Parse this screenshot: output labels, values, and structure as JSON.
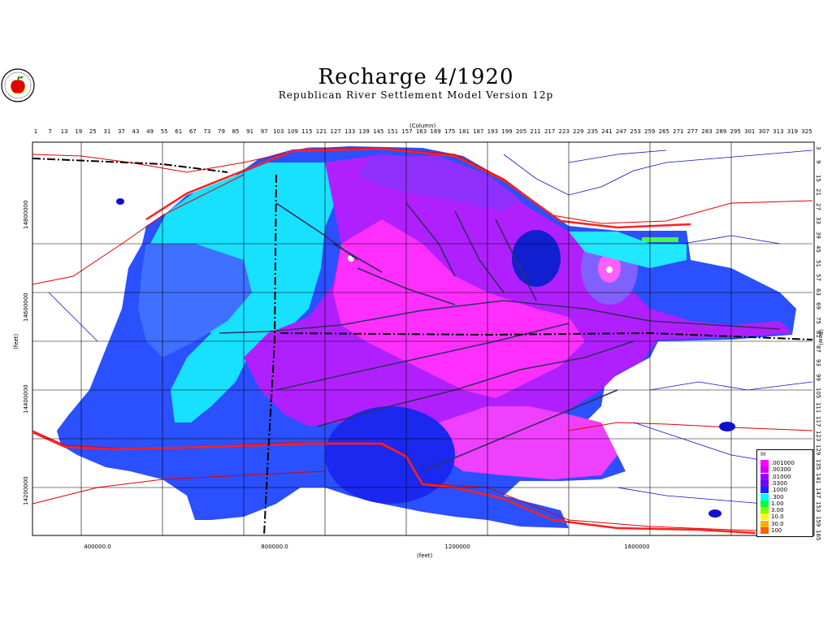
{
  "title": "Recharge   4/1920",
  "subtitle": "Republican River Settlement Model Version 12p",
  "logo": "apple-logo",
  "axes": {
    "top_label": "(Column)",
    "right_label": "(Row)",
    "bottom_label": "(feet)",
    "left_label": "(feet)",
    "column_ticks": [
      "1",
      "7",
      "13",
      "19",
      "25",
      "31",
      "37",
      "43",
      "49",
      "55",
      "61",
      "67",
      "73",
      "79",
      "85",
      "91",
      "97",
      "103",
      "109",
      "115",
      "121",
      "127",
      "133",
      "139",
      "145",
      "151",
      "157",
      "163",
      "169",
      "175",
      "181",
      "187",
      "193",
      "199",
      "205",
      "211",
      "217",
      "223",
      "229",
      "235",
      "241",
      "247",
      "253",
      "259",
      "265",
      "271",
      "277",
      "283",
      "289",
      "295",
      "301",
      "307",
      "313",
      "319",
      "325"
    ],
    "row_ticks": [
      "3",
      "9",
      "15",
      "21",
      "27",
      "33",
      "39",
      "45",
      "51",
      "57",
      "63",
      "69",
      "75",
      "81",
      "87",
      "93",
      "99",
      "105",
      "111",
      "117",
      "123",
      "129",
      "135",
      "141",
      "147",
      "153",
      "159",
      "165"
    ],
    "x_ticks": [
      "400000.0",
      "800000.0",
      "1200000",
      "1600000"
    ],
    "y_ticks": [
      "14800000",
      "14600000",
      "14400000",
      "14200000"
    ]
  },
  "legend": {
    "title": "In",
    "items": [
      {
        "label": ".001000",
        "color": "#ff00ff"
      },
      {
        "label": ".00300",
        "color": "#d000ff"
      },
      {
        "label": ".01000",
        "color": "#a000ff"
      },
      {
        "label": ".0300",
        "color": "#7000ff"
      },
      {
        "label": ".1000",
        "color": "#2020ff"
      },
      {
        "label": ".300",
        "color": "#00ffff"
      },
      {
        "label": "1.00",
        "color": "#00ff40"
      },
      {
        "label": "3.00",
        "color": "#80ff00"
      },
      {
        "label": "10.0",
        "color": "#ffff00"
      },
      {
        "label": "30.0",
        "color": "#ffb000"
      },
      {
        "label": "100",
        "color": "#ff6000"
      }
    ]
  }
}
